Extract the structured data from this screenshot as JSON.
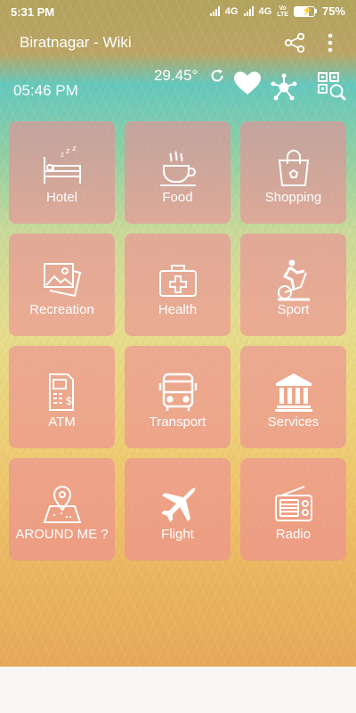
{
  "status_bar": {
    "time": "5:31 PM",
    "network_1": "4G",
    "network_2": "4G",
    "volte_top": "Vo",
    "volte_bottom": "LTE",
    "battery_percent": "75%",
    "battery_level": 0.75,
    "battery_color": "#3dbb4f"
  },
  "app_bar": {
    "title": "Biratnagar - Wiki",
    "share_icon": "share-icon",
    "more_icon": "more-vert-icon"
  },
  "info": {
    "clock": "05:46 PM",
    "temperature": "29.45°",
    "refresh_icon": "refresh-icon",
    "favorite_icon": "heart-icon",
    "network_icon": "hub-icon",
    "scan_icon": "qr-scan-icon"
  },
  "tiles": [
    {
      "label": "Hotel",
      "icon": "bed-icon"
    },
    {
      "label": "Food",
      "icon": "coffee-cup-icon"
    },
    {
      "label": "Shopping",
      "icon": "shopping-bag-icon"
    },
    {
      "label": "Recreation",
      "icon": "pictures-icon"
    },
    {
      "label": "Health",
      "icon": "medical-kit-icon"
    },
    {
      "label": "Sport",
      "icon": "exercise-bike-icon"
    },
    {
      "label": "ATM",
      "icon": "atm-icon"
    },
    {
      "label": "Transport",
      "icon": "bus-icon"
    },
    {
      "label": "Services",
      "icon": "bank-building-icon"
    },
    {
      "label": "AROUND ME ?",
      "icon": "map-pin-icon"
    },
    {
      "label": "Flight",
      "icon": "airplane-icon"
    },
    {
      "label": "Radio",
      "icon": "radio-icon"
    }
  ],
  "colors": {
    "tile_background": "#ee8c96",
    "text": "#ffffff"
  }
}
